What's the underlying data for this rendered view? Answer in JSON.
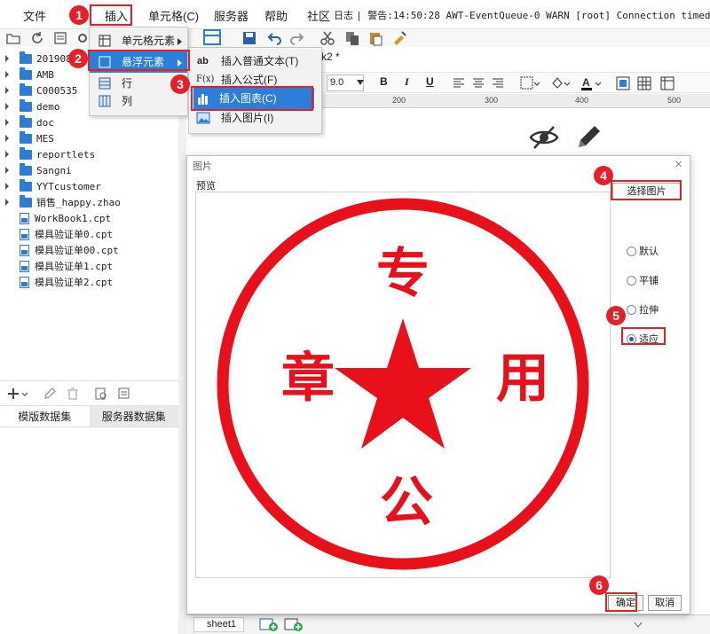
{
  "menubar": {
    "items": [
      "文件",
      "插入",
      "单元格(C)",
      "服务器",
      "帮助",
      "社区"
    ],
    "log_label": "日志",
    "log_text": "| 警告:14:50:28 AWT-EventQueue-0 WARN [root] Connection timed out"
  },
  "tree": {
    "folders": [
      "201908",
      "AMB",
      "C000535",
      "demo",
      "doc",
      "MES",
      "reportlets",
      "Sangni",
      "YYTcustomer",
      "销售_happy.zhao"
    ],
    "files": [
      "WorkBook1.cpt",
      "模具验证单0.cpt",
      "模具验证单00.cpt",
      "模具验证单1.cpt",
      "模具验证单2.cpt"
    ]
  },
  "dataset_tabs": [
    "模版数据集",
    "服务器数据集"
  ],
  "editor": {
    "doc_tab": "k2 *",
    "font_size": "9.0",
    "ruler_marks": [
      "200",
      "300",
      "400",
      "500"
    ]
  },
  "sheet_tab": "sheet1",
  "insert_menu": {
    "items": [
      "单元格元素",
      "悬浮元素",
      "行",
      "列"
    ]
  },
  "float_submenu": {
    "items": [
      "插入普通文本(T)",
      "插入公式(F)",
      "插入图表(C)",
      "插入图片(I)"
    ],
    "icon_texts": [
      "ab",
      "F(x)"
    ]
  },
  "dialog": {
    "title": "图片",
    "close": "×",
    "preview_label": "预览",
    "choose_button": "选择图片",
    "layout_options": [
      "默认",
      "平铺",
      "拉伸",
      "适应"
    ],
    "selected_option": "适应",
    "ok_button": "确定",
    "cancel_button": "取消",
    "stamp_chars": {
      "top": "专",
      "left": "章",
      "right": "用",
      "bottom": "公"
    }
  },
  "badges": [
    "1",
    "2",
    "3",
    "4",
    "5",
    "6"
  ],
  "colors": {
    "highlight": "#e5202a",
    "menu_hover": "#2b7fd8",
    "stamp_red": "#e8101a",
    "folder": "#2e7cd6"
  }
}
